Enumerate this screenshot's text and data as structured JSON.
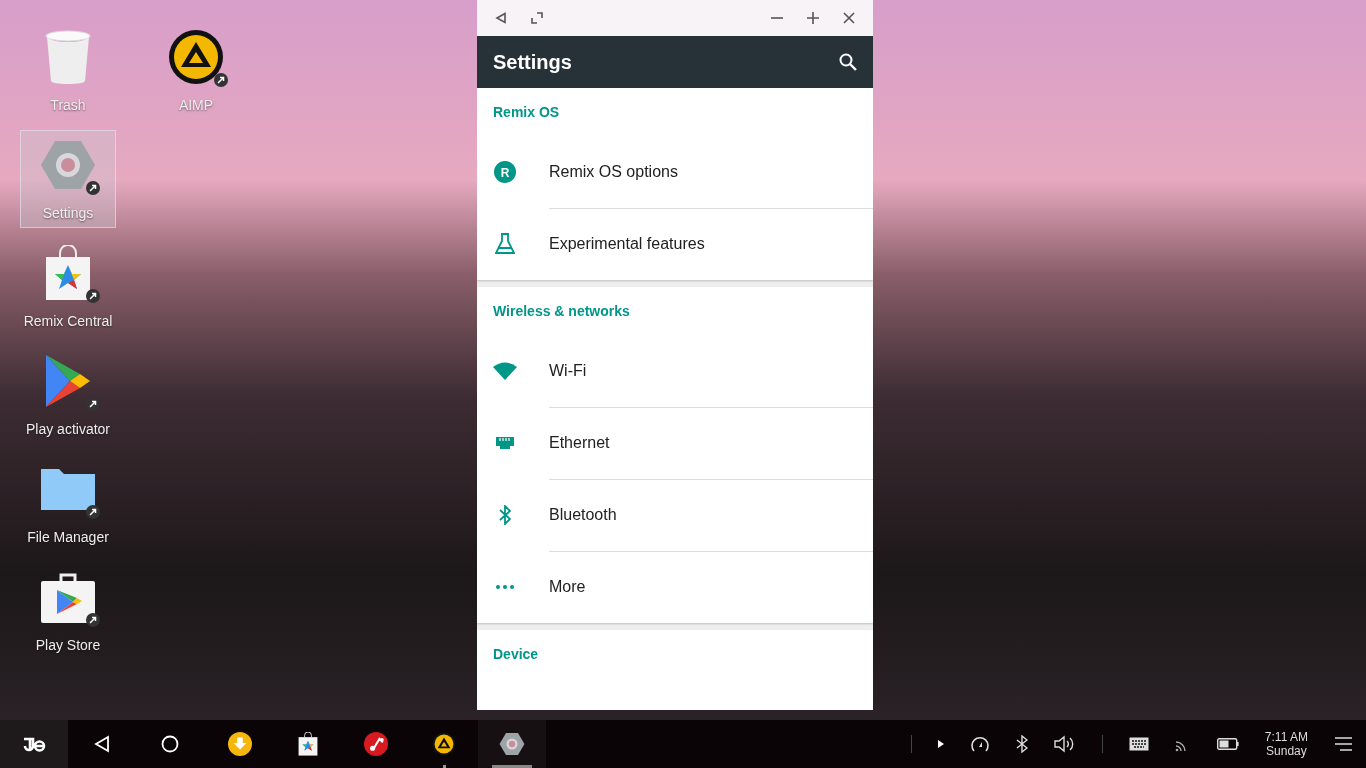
{
  "desktop": {
    "icons": [
      {
        "kind": "trash",
        "label": "Trash",
        "selected": false,
        "shortcut": false
      },
      {
        "kind": "aimp",
        "label": "AIMP",
        "selected": false,
        "shortcut": true
      },
      {
        "kind": "settings",
        "label": "Settings",
        "selected": true,
        "shortcut": true
      },
      {
        "kind": "central",
        "label": "Remix Central",
        "selected": false,
        "shortcut": true
      },
      {
        "kind": "play",
        "label": "Play activator",
        "selected": false,
        "shortcut": true
      },
      {
        "kind": "folder",
        "label": "File Manager",
        "selected": false,
        "shortcut": true
      },
      {
        "kind": "store",
        "label": "Play Store",
        "selected": false,
        "shortcut": true
      }
    ]
  },
  "window": {
    "title": "Settings",
    "sections": [
      {
        "header": "Remix OS",
        "items": [
          {
            "kind": "remix",
            "label": "Remix OS options",
            "glyph": "R"
          },
          {
            "kind": "flask",
            "label": "Experimental features"
          }
        ]
      },
      {
        "header": "Wireless & networks",
        "items": [
          {
            "kind": "wifi",
            "label": "Wi-Fi"
          },
          {
            "kind": "ethernet",
            "label": "Ethernet"
          },
          {
            "kind": "bluetooth",
            "label": "Bluetooth"
          },
          {
            "kind": "more",
            "label": "More"
          }
        ]
      },
      {
        "header": "Device"
      }
    ]
  },
  "taskbar": {
    "apps": [
      {
        "kind": "download",
        "running": false,
        "focused": false
      },
      {
        "kind": "central",
        "running": false,
        "focused": false
      },
      {
        "kind": "music",
        "running": false,
        "focused": false
      },
      {
        "kind": "aimp",
        "running": true,
        "focused": false
      },
      {
        "kind": "settings",
        "running": true,
        "focused": true
      }
    ],
    "clock": {
      "time": "7:11 AM",
      "day": "Sunday"
    }
  }
}
